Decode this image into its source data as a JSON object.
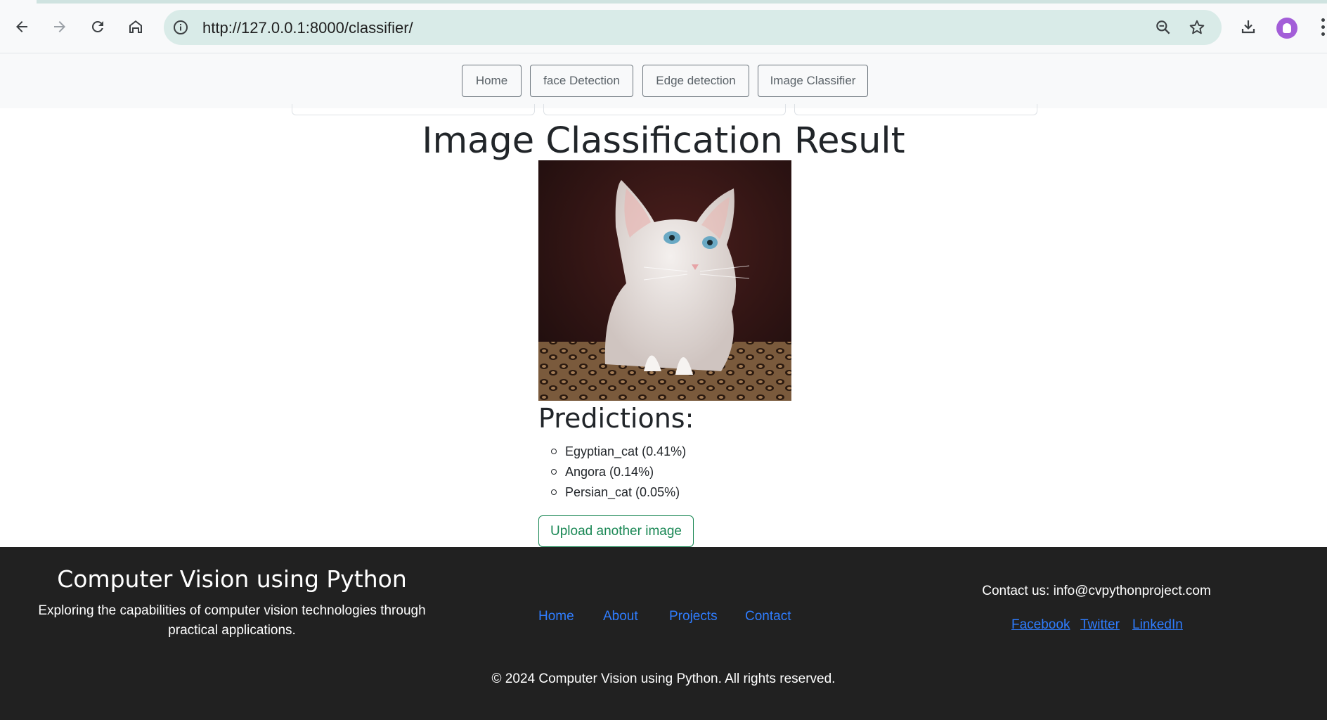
{
  "browser": {
    "url": "http://127.0.0.1:8000/classifier/",
    "icons": [
      "back-icon",
      "forward-icon",
      "reload-icon",
      "home-icon",
      "site-info-icon",
      "zoom-icon",
      "bookmark-star-icon",
      "download-icon",
      "profile-avatar",
      "more-menu-icon"
    ]
  },
  "nav": {
    "home": "Home",
    "face": "face Detection",
    "edge": "Edge detection",
    "classifier": "Image Classifier"
  },
  "main": {
    "title": "Image Classification Result",
    "predictions_title": "Predictions:",
    "predictions": [
      "Egyptian_cat (0.41%)",
      "Angora (0.14%)",
      "Persian_cat (0.05%)"
    ],
    "upload_button": "Upload another image"
  },
  "footer": {
    "brand": "Computer Vision using Python",
    "tagline": "Exploring the capabilities of computer vision technologies through practical applications.",
    "links": [
      "Home",
      "About",
      "Projects",
      "Contact"
    ],
    "contact": "Contact us: info@cvpythonproject.com",
    "social": [
      "Facebook",
      "Twitter",
      "LinkedIn"
    ],
    "copyright": "© 2024 Computer Vision using Python. All rights reserved."
  },
  "colors": {
    "link": "#2f7dff",
    "success": "#198754",
    "footer_bg": "#212121",
    "omnibox": "#d9ebe8"
  }
}
